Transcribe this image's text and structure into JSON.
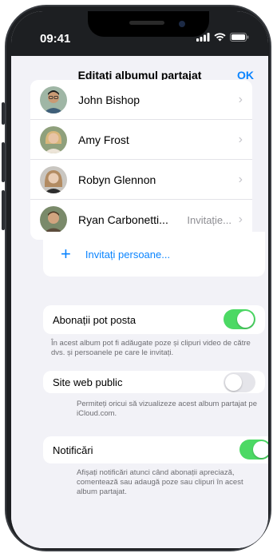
{
  "status_bar": {
    "time": "09:41"
  },
  "header": {
    "title": "Editați albumul partajat",
    "ok_label": "OK"
  },
  "people": [
    {
      "name": "John Bishop",
      "status": ""
    },
    {
      "name": "Amy Frost",
      "status": ""
    },
    {
      "name": "Robyn Glennon",
      "status": ""
    },
    {
      "name": "Ryan Carbonetti...",
      "status": "Invitație..."
    }
  ],
  "invite": {
    "label": "Invitați persoane..."
  },
  "subscribers_post": {
    "label": "Abonații pot posta",
    "on": true,
    "footnote": "În acest album pot fi adăugate poze și clipuri video de către dvs. și persoanele pe care le invitați."
  },
  "public_website": {
    "label": "Site web public",
    "on": false,
    "footnote": "Permiteți oricui să vizualizeze acest album partajat pe iCloud.com."
  },
  "notifications": {
    "label": "Notificări",
    "on": true,
    "footnote": "Afișați notificări atunci când abonații apreciază, comentează sau adaugă poze sau clipuri în acest album partajat."
  },
  "colors": {
    "accent": "#0a84ff",
    "switch_on": "#4cd964",
    "background": "#f2f2f7"
  }
}
